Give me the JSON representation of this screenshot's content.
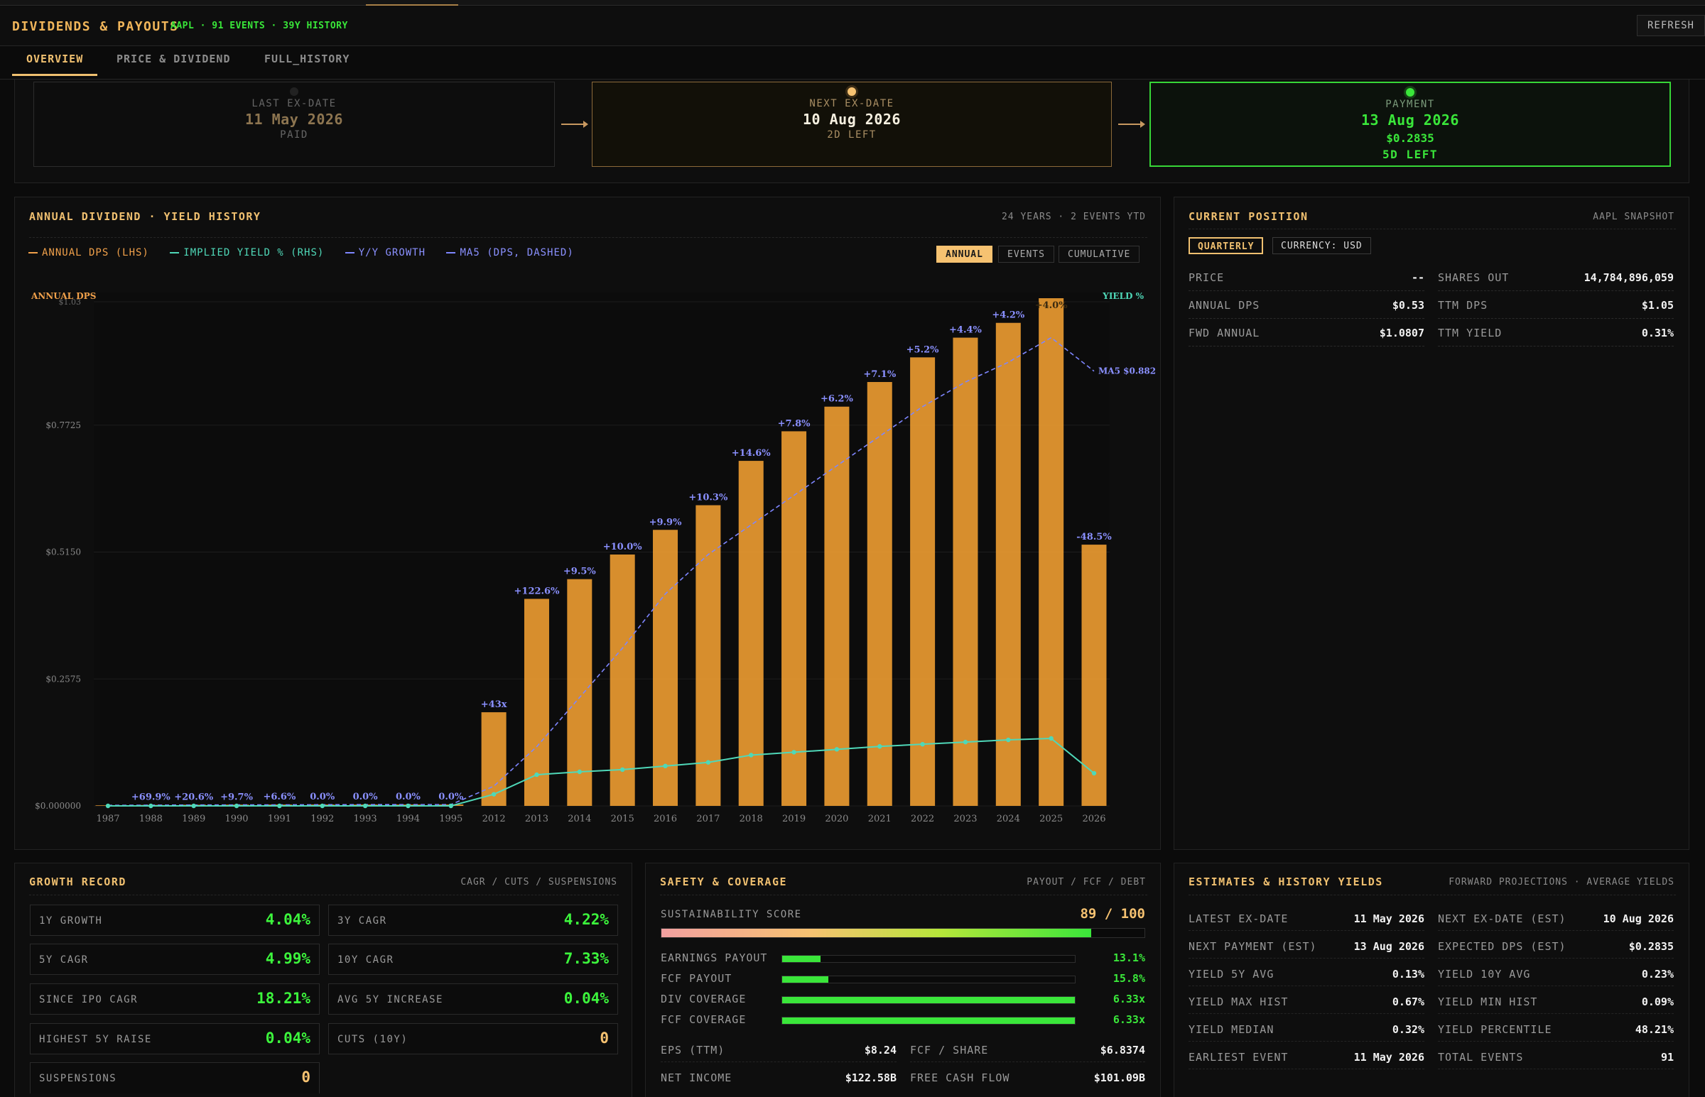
{
  "header": {
    "title": "DIVIDENDS & PAYOUTS",
    "subtitle": "AAPL · 91 EVENTS · 39Y HISTORY",
    "refresh_label": "REFRESH"
  },
  "tabs": [
    {
      "label": "OVERVIEW"
    },
    {
      "label": "PRICE & DIVIDEND"
    },
    {
      "label": "FULL_HISTORY"
    }
  ],
  "dates": {
    "last": {
      "label": "LAST EX-DATE",
      "date": "11 May 2026",
      "status": "PAID"
    },
    "next": {
      "label": "NEXT EX-DATE",
      "date": "10 Aug 2026",
      "status": "2D LEFT"
    },
    "payment": {
      "label": "PAYMENT",
      "date": "13 Aug 2026",
      "amount": "$0.2835",
      "status": "5D LEFT"
    }
  },
  "chart_panel": {
    "title": "ANNUAL DIVIDEND · YIELD HISTORY",
    "right": "24 YEARS · 2 EVENTS YTD",
    "legend": [
      {
        "label": "ANNUAL DPS (LHS)",
        "color": "#f0a04a"
      },
      {
        "label": "IMPLIED YIELD % (RHS)",
        "color": "#4fd8b8"
      },
      {
        "label": "Y/Y GROWTH",
        "color": "#7e86ff"
      },
      {
        "label": "MA5 (DPS, DASHED)",
        "color": "#7e86ff"
      }
    ],
    "toggles": [
      "ANNUAL",
      "EVENTS",
      "CUMULATIVE"
    ]
  },
  "chart_data": {
    "type": "bar",
    "left_axis_label": "ANNUAL DPS",
    "right_axis_label": "YIELD %",
    "top_tick": "$1.03",
    "y_ticks": [
      "$0.000000",
      "$0.2575",
      "$0.5150",
      "$0.7725"
    ],
    "ylim": [
      0,
      1.03
    ],
    "categories": [
      "1987",
      "1988",
      "1989",
      "1990",
      "1991",
      "1992",
      "1993",
      "1994",
      "1995",
      "2012",
      "2013",
      "2014",
      "2015",
      "2016",
      "2017",
      "2018",
      "2019",
      "2020",
      "2021",
      "2022",
      "2023",
      "2024",
      "2025",
      "2026"
    ],
    "dps": [
      0.0011,
      0.0019,
      0.0023,
      0.0025,
      0.0027,
      0.0027,
      0.0027,
      0.0027,
      0.0027,
      0.19,
      0.42,
      0.46,
      0.51,
      0.56,
      0.61,
      0.7,
      0.76,
      0.81,
      0.86,
      0.91,
      0.95,
      0.98,
      1.03,
      0.53
    ],
    "growth_labels": [
      "",
      "+69.9%",
      "+20.6%",
      "+9.7%",
      "+6.6%",
      "0.0%",
      "0.0%",
      "0.0%",
      "0.0%",
      "+43x",
      "+122.6%",
      "+9.5%",
      "+10.0%",
      "+9.9%",
      "+10.3%",
      "+14.6%",
      "+7.8%",
      "+6.2%",
      "+7.1%",
      "+5.2%",
      "+4.4%",
      "+4.2%",
      "+4.0%",
      "-48.5%"
    ],
    "yield": [
      0.0,
      0.0,
      0.0,
      0.0,
      0.0,
      0.0,
      0.0,
      0.0,
      0.0,
      0.016,
      0.043,
      0.047,
      0.05,
      0.055,
      0.06,
      0.07,
      0.074,
      0.078,
      0.082,
      0.085,
      0.088,
      0.091,
      0.093,
      0.045
    ],
    "ma5": [
      0.0011,
      0.0015,
      0.0018,
      0.002,
      0.0021,
      0.0024,
      0.0026,
      0.0027,
      0.0027,
      0.04,
      0.12,
      0.22,
      0.32,
      0.43,
      0.51,
      0.57,
      0.63,
      0.69,
      0.75,
      0.81,
      0.86,
      0.9,
      0.95,
      0.882
    ],
    "ma5_label": "MA5 $0.882"
  },
  "position": {
    "title": "CURRENT POSITION",
    "right": "AAPL SNAPSHOT",
    "chips": [
      "QUARTERLY",
      "CURRENCY: USD"
    ],
    "rows": [
      {
        "k1": "PRICE",
        "v1": "--",
        "k2": "SHARES OUT",
        "v2": "14,784,896,059"
      },
      {
        "k1": "ANNUAL DPS",
        "v1": "$0.53",
        "k2": "TTM DPS",
        "v2": "$1.05"
      },
      {
        "k1": "FWD ANNUAL",
        "v1": "$1.0807",
        "k2": "TTM YIELD",
        "v2": "0.31%"
      }
    ]
  },
  "growth": {
    "title": "GROWTH RECORD",
    "right": "CAGR / CUTS / SUSPENSIONS",
    "items": [
      {
        "k": "1Y GROWTH",
        "v": "4.04%"
      },
      {
        "k": "3Y CAGR",
        "v": "4.22%"
      },
      {
        "k": "5Y CAGR",
        "v": "4.99%"
      },
      {
        "k": "10Y CAGR",
        "v": "7.33%"
      },
      {
        "k": "SINCE IPO CAGR",
        "v": "18.21%"
      },
      {
        "k": "AVG 5Y INCREASE",
        "v": "0.04%"
      },
      {
        "k": "HIGHEST 5Y RAISE",
        "v": "0.04%"
      },
      {
        "k": "CUTS (10Y)",
        "v": "0"
      },
      {
        "k": "SUSPENSIONS",
        "v": "0"
      }
    ]
  },
  "safety": {
    "title": "SAFETY & COVERAGE",
    "right": "PAYOUT / FCF / DEBT",
    "score_label": "SUSTAINABILITY SCORE",
    "score": "89 / 100",
    "score_fraction": 0.89,
    "bars": [
      {
        "k": "EARNINGS PAYOUT",
        "v": "13.1%",
        "fraction": 0.131
      },
      {
        "k": "FCF PAYOUT",
        "v": "15.8%",
        "fraction": 0.158
      },
      {
        "k": "DIV COVERAGE",
        "v": "6.33x",
        "fraction": 1.0
      },
      {
        "k": "FCF COVERAGE",
        "v": "6.33x",
        "fraction": 1.0
      }
    ],
    "kv": [
      {
        "k1": "EPS (TTM)",
        "v1": "$8.24",
        "k2": "FCF / SHARE",
        "v2": "$6.8374"
      },
      {
        "k1": "NET INCOME",
        "v1": "$122.58B",
        "k2": "FREE CASH FLOW",
        "v2": "$101.09B"
      }
    ]
  },
  "estimates": {
    "title": "ESTIMATES & HISTORY YIELDS",
    "right": "FORWARD PROJECTIONS · AVERAGE YIELDS",
    "rows": [
      {
        "k1": "LATEST EX-DATE",
        "v1": "11 May 2026",
        "k2": "NEXT EX-DATE (EST)",
        "v2": "10 Aug 2026"
      },
      {
        "k1": "NEXT PAYMENT (EST)",
        "v1": "13 Aug 2026",
        "k2": "EXPECTED DPS (EST)",
        "v2": "$0.2835"
      },
      {
        "k1": "YIELD 5Y AVG",
        "v1": "0.13%",
        "k2": "YIELD 10Y AVG",
        "v2": "0.23%"
      },
      {
        "k1": "YIELD MAX HIST",
        "v1": "0.67%",
        "k2": "YIELD MIN HIST",
        "v2": "0.09%"
      },
      {
        "k1": "YIELD MEDIAN",
        "v1": "0.32%",
        "k2": "YIELD PERCENTILE",
        "v2": "48.21%"
      },
      {
        "k1": "EARLIEST EVENT",
        "v1": "11 May 2026",
        "k2": "TOTAL EVENTS",
        "v2": "91"
      }
    ]
  }
}
